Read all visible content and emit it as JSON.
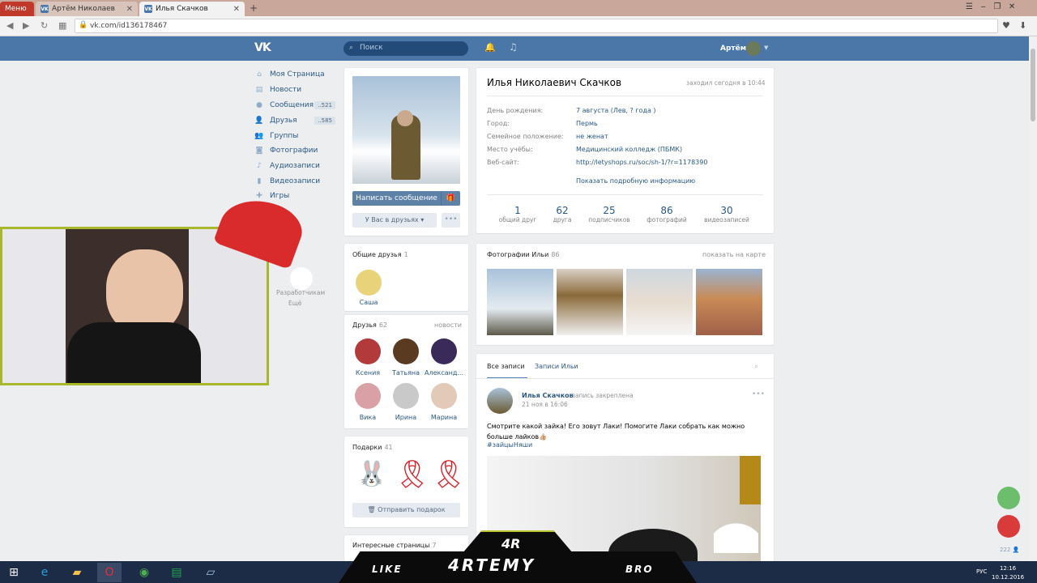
{
  "browser": {
    "menu_label": "Меню",
    "tabs": [
      {
        "title": "Артём Николаев"
      },
      {
        "title": "Илья Скачков"
      }
    ],
    "new_tab": "+",
    "url": "vk.com/id136178467"
  },
  "vk_header": {
    "logo": "VK",
    "search_placeholder": "Поиск",
    "user_name": "Артём"
  },
  "left_menu": [
    {
      "label": "Моя Страница",
      "icon": "home-icon"
    },
    {
      "label": "Новости",
      "icon": "news-icon"
    },
    {
      "label": "Сообщения",
      "icon": "messages-icon",
      "badge": "..521"
    },
    {
      "label": "Друзья",
      "icon": "friends-icon",
      "badge": "..585"
    },
    {
      "label": "Группы",
      "icon": "groups-icon"
    },
    {
      "label": "Фотографии",
      "icon": "camera-icon"
    },
    {
      "label": "Аудиозаписи",
      "icon": "music-icon"
    },
    {
      "label": "Видеозаписи",
      "icon": "video-icon"
    },
    {
      "label": "Игры",
      "icon": "games-icon"
    }
  ],
  "footer_links": {
    "developers": "Разработчикам",
    "more": "Ещё"
  },
  "profile": {
    "send_message": "Написать сообщение",
    "in_friends": "У Вас в друзьях",
    "more": "•••",
    "name": "Илья Николаевич Скачков",
    "last_seen": "заходил сегодня в 10:44",
    "info": [
      {
        "key": "День рождения:",
        "value": "7 августа (Лев, ? года )"
      },
      {
        "key": "Город:",
        "value": "Пермь"
      },
      {
        "key": "Семейное положение:",
        "value": "не женат"
      },
      {
        "key": "Место учёбы:",
        "value": "Медицинский колледж (ПБМК)"
      },
      {
        "key": "Веб-сайт:",
        "value": "http://letyshops.ru/soc/sh-1/?r=1178390"
      }
    ],
    "show_more": "Показать подробную информацию",
    "stats": [
      {
        "n": "1",
        "l": "общий друг"
      },
      {
        "n": "62",
        "l": "друга"
      },
      {
        "n": "25",
        "l": "подписчиков"
      },
      {
        "n": "86",
        "l": "фотографий"
      },
      {
        "n": "30",
        "l": "видеозаписей"
      }
    ]
  },
  "mutual": {
    "title": "Общие друзья",
    "count": "1",
    "friend": "Саша"
  },
  "friends": {
    "title": "Друзья",
    "count": "62",
    "news": "новости",
    "list": [
      "Ксения",
      "Татьяна",
      "Александ...",
      "Вика",
      "Ирина",
      "Марина"
    ]
  },
  "gifts": {
    "title": "Подарки",
    "count": "41",
    "send": "Отправить подарок"
  },
  "pages": {
    "title": "Интересные страницы",
    "count": "7"
  },
  "photos": {
    "title": "Фотографии Ильи",
    "count": "86",
    "map": "показать на карте"
  },
  "wall": {
    "tabs": [
      "Все записи",
      "Записи Ильи"
    ],
    "author": "Илья Скачков",
    "pinned": "запись закреплена",
    "date": "21 ноя в 16:06",
    "text": "Смотрите какой зайка! Его зовут Лаки! Помогите Лаки собрать как можно больше лайков👍🏼",
    "hashtag": "#зайцыНяши"
  },
  "side_widget": {
    "count": "222"
  },
  "taskbar": {
    "lang": "РУС",
    "time": "12:16",
    "date": "10.12.2016"
  },
  "overlay": {
    "left": "LIKE",
    "logo": "4RTEMY",
    "right": "BRO",
    "small": "4R"
  }
}
